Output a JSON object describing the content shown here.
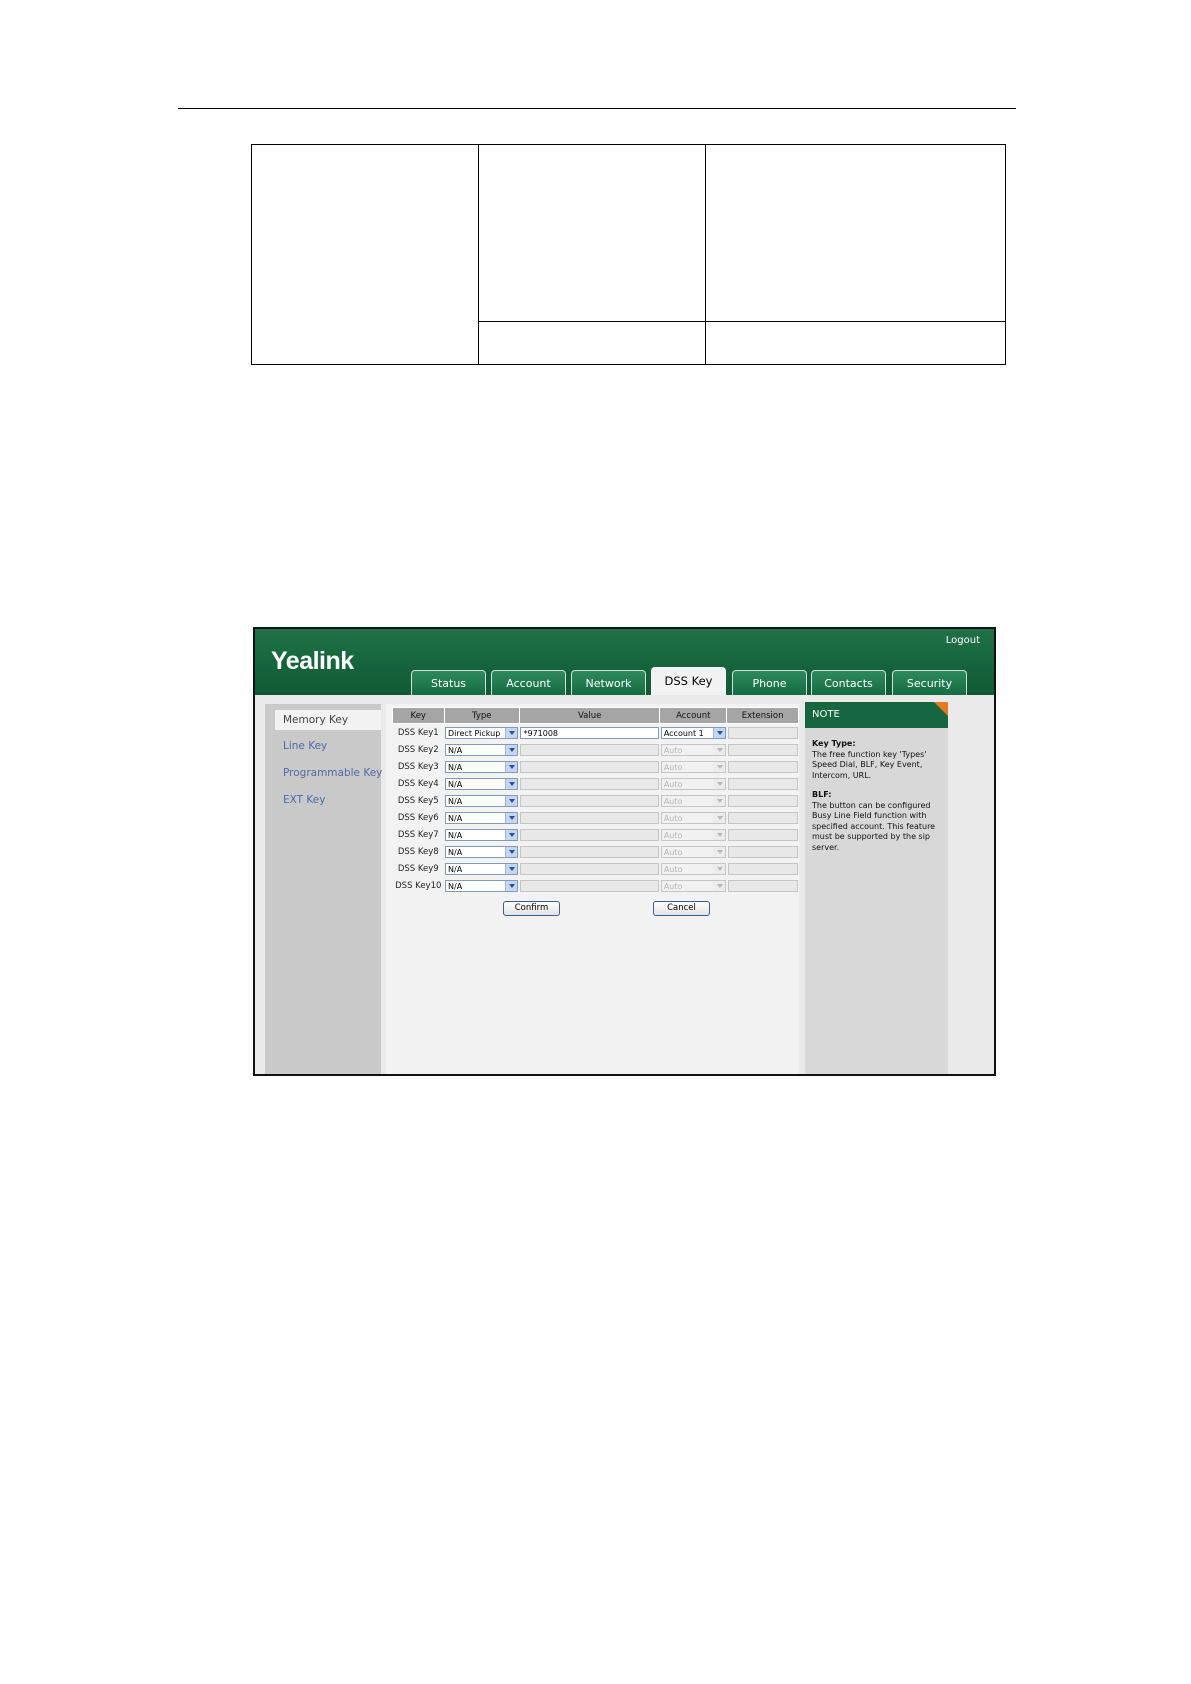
{
  "dss_page": {
    "logo": "Yealink",
    "logout": "Logout",
    "tabs": [
      {
        "label": "Status"
      },
      {
        "label": "Account"
      },
      {
        "label": "Network"
      },
      {
        "label": "DSS Key"
      },
      {
        "label": "Phone"
      },
      {
        "label": "Contacts"
      },
      {
        "label": "Security"
      }
    ],
    "active_tab": "DSS Key",
    "sidebar": [
      {
        "label": "Memory Key"
      },
      {
        "label": "Line Key"
      },
      {
        "label": "Programmable Key"
      },
      {
        "label": "EXT Key"
      }
    ],
    "columns": [
      "Key",
      "Type",
      "Value",
      "Account",
      "Extension"
    ],
    "rows": [
      {
        "key": "DSS Key1",
        "type": "Direct Pickup",
        "value": "*971008",
        "account": "Account 1",
        "extension": ""
      },
      {
        "key": "DSS Key2",
        "type": "N/A",
        "value": "",
        "account": "Auto",
        "extension": ""
      },
      {
        "key": "DSS Key3",
        "type": "N/A",
        "value": "",
        "account": "Auto",
        "extension": ""
      },
      {
        "key": "DSS Key4",
        "type": "N/A",
        "value": "",
        "account": "Auto",
        "extension": ""
      },
      {
        "key": "DSS Key5",
        "type": "N/A",
        "value": "",
        "account": "Auto",
        "extension": ""
      },
      {
        "key": "DSS Key6",
        "type": "N/A",
        "value": "",
        "account": "Auto",
        "extension": ""
      },
      {
        "key": "DSS Key7",
        "type": "N/A",
        "value": "",
        "account": "Auto",
        "extension": ""
      },
      {
        "key": "DSS Key8",
        "type": "N/A",
        "value": "",
        "account": "Auto",
        "extension": ""
      },
      {
        "key": "DSS Key9",
        "type": "N/A",
        "value": "",
        "account": "Auto",
        "extension": ""
      },
      {
        "key": "DSS Key10",
        "type": "N/A",
        "value": "",
        "account": "Auto",
        "extension": ""
      }
    ],
    "buttons": {
      "confirm": "Confirm",
      "cancel": "Cancel"
    },
    "note": {
      "heading": "NOTE",
      "key_type_title": "Key Type:",
      "key_type_text": "The free function key 'Types' Speed Dial, BLF, Key Event, Intercom, URL.",
      "blf_title": "BLF:",
      "blf_text": "The button can be configured Busy Line Field function with specified account. This feature must be supported by the sip server."
    }
  }
}
